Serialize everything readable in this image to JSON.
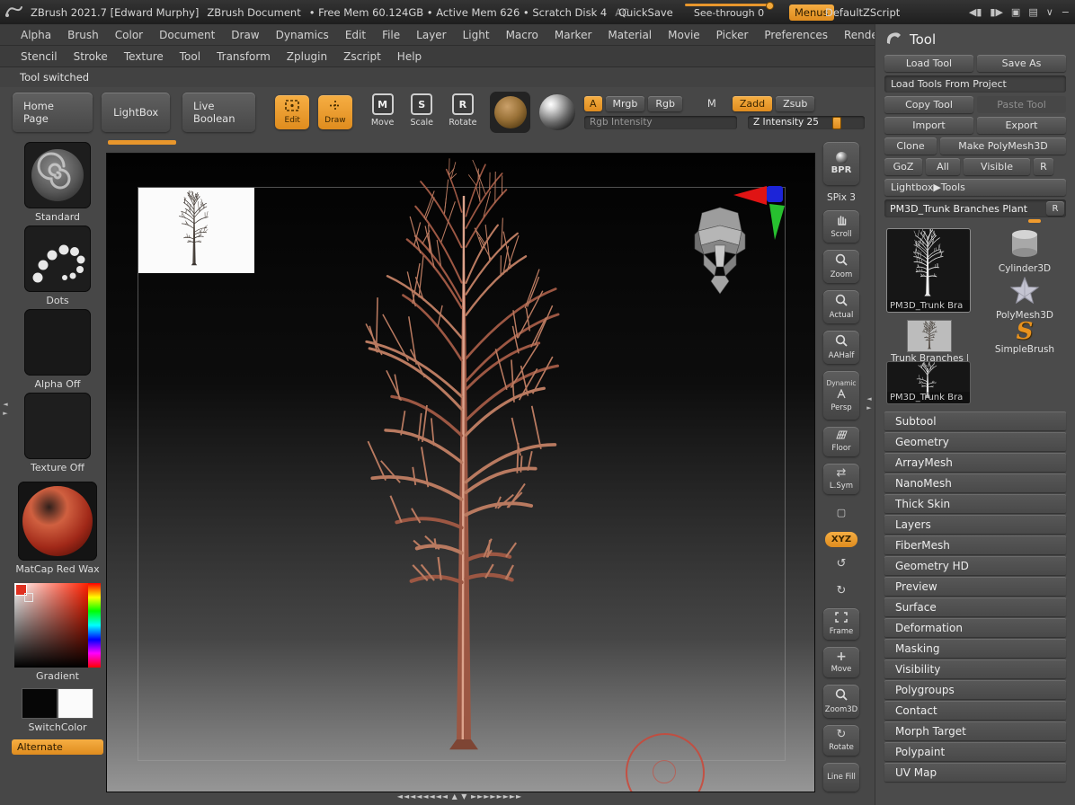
{
  "titlebar": {
    "app_title": "ZBrush 2021.7 [Edward Murphy]",
    "document_title": "ZBrush Document",
    "memory_info": "• Free Mem 60.124GB • Active Mem 626 • Scratch Disk 4",
    "ac_label": "AC",
    "quicksave_label": "QuickSave",
    "see_through_label": "See-through 0",
    "menus_label": "Menus",
    "zscript_label": "DefaultZScript"
  },
  "menubar": {
    "row1": [
      "Alpha",
      "Brush",
      "Color",
      "Document",
      "Draw",
      "Dynamics",
      "Edit",
      "File",
      "Layer",
      "Light",
      "Macro",
      "Marker",
      "Material",
      "Movie",
      "Picker",
      "Preferences",
      "Render"
    ],
    "row2": [
      "Stencil",
      "Stroke",
      "Texture",
      "Tool",
      "Transform",
      "Zplugin",
      "Zscript",
      "Help"
    ]
  },
  "status_message": "Tool switched",
  "shelf": {
    "home_page": "Home Page",
    "lightbox": "LightBox",
    "live_boolean": "Live Boolean",
    "edit": "Edit",
    "draw": "Draw",
    "move": "Move",
    "scale": "Scale",
    "rotate": "Rotate",
    "a_label": "A",
    "mrgb": "Mrgb",
    "rgb": "Rgb",
    "m_label": "M",
    "zadd": "Zadd",
    "zsub": "Zsub",
    "rgb_intensity": "Rgb Intensity",
    "z_intensity": "Z Intensity 25"
  },
  "left_panel": {
    "brush_label": "Standard",
    "stroke_label": "Dots",
    "alpha_label": "Alpha Off",
    "texture_label": "Texture Off",
    "material_label": "MatCap Red Wax",
    "gradient_label": "Gradient",
    "switch_label": "SwitchColor",
    "alternate_label": "Alternate"
  },
  "canvas": {
    "scrollbar_left": "◄◄◄◄◄◄◄◄",
    "scrollbar_mid": "▲ ▼",
    "scrollbar_right": "►►►►►►►►"
  },
  "right_toolbar": {
    "bpr": "BPR",
    "spix": "SPix 3",
    "scroll": "Scroll",
    "zoom": "Zoom",
    "actual": "Actual",
    "aahalf": "AAHalf",
    "dynamic": "Dynamic",
    "persp": "Persp",
    "floor": "Floor",
    "lsym": "L.Sym",
    "xyz": "XYZ",
    "frame": "Frame",
    "move": "Move",
    "zoom3d": "Zoom3D",
    "rotate": "Rotate",
    "line_fill": "Line Fill"
  },
  "tool_panel": {
    "title": "Tool",
    "load_tool": "Load Tool",
    "save_as": "Save As",
    "load_from_project": "Load Tools From Project",
    "copy_tool": "Copy Tool",
    "paste_tool": "Paste Tool",
    "import": "Import",
    "export": "Export",
    "clone": "Clone",
    "make_polymesh": "Make PolyMesh3D",
    "goz": "GoZ",
    "all": "All",
    "visible": "Visible",
    "r_button": "R",
    "lightbox_tools": "Lightbox▶Tools",
    "current_tool_name": "PM3D_Trunk Branches Plant",
    "current_tool_r": "R",
    "thumbs": {
      "selected": "PM3D_Trunk Bra",
      "cylinder": "Cylinder3D",
      "polymesh": "PolyMesh3D",
      "trunk_branches": "Trunk Branches I",
      "simplebrush": "SimpleBrush",
      "recent": "PM3D_Trunk Bra"
    },
    "sections": [
      "Subtool",
      "Geometry",
      "ArrayMesh",
      "NanoMesh",
      "Thick Skin",
      "Layers",
      "FiberMesh",
      "Geometry HD",
      "Preview",
      "Surface",
      "Deformation",
      "Masking",
      "Visibility",
      "Polygroups",
      "Contact",
      "Morph Target",
      "Polypaint",
      "UV Map"
    ]
  },
  "icons": {
    "move_box": "M",
    "scale_box": "S",
    "rotate_box": "R",
    "spin_left": "↺",
    "spin_right": "↻",
    "rotate_glyph": "↻",
    "move_glyph": "+",
    "lsym_glyph": "⇄",
    "local_glyph": "▢",
    "splitter_left": "◄",
    "splitter_right": "►",
    "panel_left": "◀▮",
    "panel_right": "▮▶",
    "window_a": "▣",
    "window_b": "▤",
    "chevron_down": "∨",
    "minimize": "−",
    "simplebrush_glyph": "S"
  },
  "colors": {
    "accent_orange": "#f09b2e",
    "tree_color": "#9c5743",
    "canvas_top": "#020202",
    "canvas_bottom": "#969696"
  }
}
